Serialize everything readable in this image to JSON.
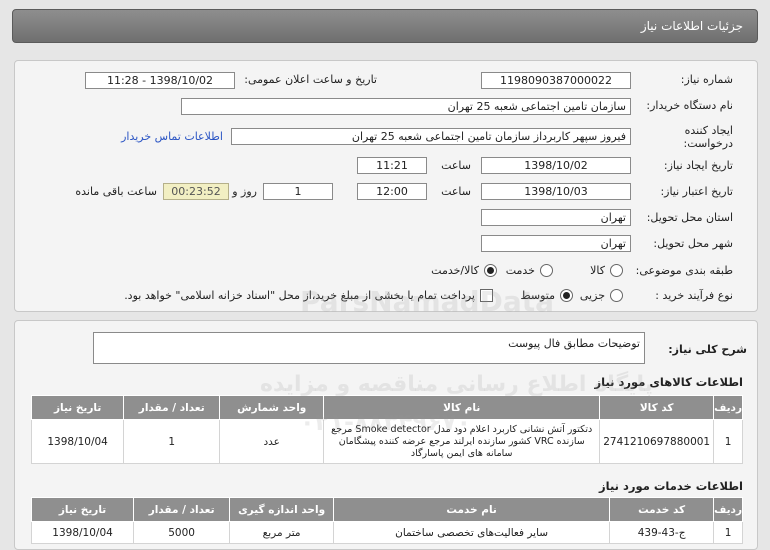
{
  "header": {
    "title": "جزئیات اطلاعات نیاز"
  },
  "info": {
    "need_number_label": "شماره نیاز:",
    "need_number": "1198090387000022",
    "announce_label": "تاریخ و ساعت اعلان عمومی:",
    "announce_value": "1398/10/02 - 11:28",
    "buyer_label": "نام دستگاه خریدار:",
    "buyer": "سازمان تامین اجتماعی شعبه 25 تهران",
    "creator_label": "ایجاد کننده درخواست:",
    "creator": "فیروز سپهر کاربرداز سازمان تامین اجتماعی شعبه 25 تهران",
    "contact_link": "اطلاعات تماس خریدار",
    "created_date_label": "تاریخ ایجاد نیاز:",
    "created_date": "1398/10/02",
    "created_time_label": "ساعت",
    "created_time": "11:21",
    "valid_date_label": "تاریخ اعتبار نیاز:",
    "valid_date": "1398/10/03",
    "valid_time_label": "ساعت",
    "valid_time": "12:00",
    "days": "1",
    "days_label": "روز و",
    "remaining": "00:23:52",
    "remaining_label": "ساعت باقی مانده",
    "province_label": "استان محل تحویل:",
    "province": "تهران",
    "city_label": "شهر محل تحویل:",
    "city": "تهران",
    "category_label": "طبقه بندی موضوعی:",
    "cat_goods": "کالا",
    "cat_service": "خدمت",
    "cat_both": "کالا/خدمت",
    "process_label": "نوع فرآیند خرید :",
    "proc_partial": "جزیی",
    "proc_medium": "متوسط",
    "payment_note": "پرداخت تمام یا بخشی از مبلغ خرید،از محل \"اسناد خزانه اسلامی\" خواهد بود."
  },
  "description": {
    "label": "شرح کلی نیاز:",
    "text": "توضیحات مطابق فال پیوست"
  },
  "goods": {
    "title": "اطلاعات کالاهای مورد نیاز",
    "headers": [
      "ردیف",
      "کد کالا",
      "نام کالا",
      "واحد شمارش",
      "تعداد / مقدار",
      "تاریخ نیاز"
    ],
    "rows": [
      [
        "1",
        "2741210697880001",
        "دتکتور آتش نشانی کاربرد اعلام دود مدل Smoke detector مرجع سازنده VRC کشور سازنده ایرلند مرجع عرضه کننده پیشگامان سامانه های ایمن پاسارگاد",
        "عدد",
        "1",
        "1398/10/04"
      ]
    ]
  },
  "services": {
    "title": "اطلاعات خدمات مورد نیاز",
    "headers": [
      "ردیف",
      "کد خدمت",
      "نام خدمت",
      "واحد اندازه گیری",
      "تعداد / مقدار",
      "تاریخ نیاز"
    ],
    "rows": [
      [
        "1",
        "ج-43-439",
        "سایر فعالیت‌های تخصصی ساختمان",
        "متر مربع",
        "5000",
        "1398/10/04"
      ]
    ]
  },
  "watermark": {
    "line1": "ParsNamadData",
    "line2": "پایگاه اطلاع رسانی مناقصه و مزایده",
    "line3": "۰۲۱-۸۸۳۴۹۶۷۰"
  }
}
